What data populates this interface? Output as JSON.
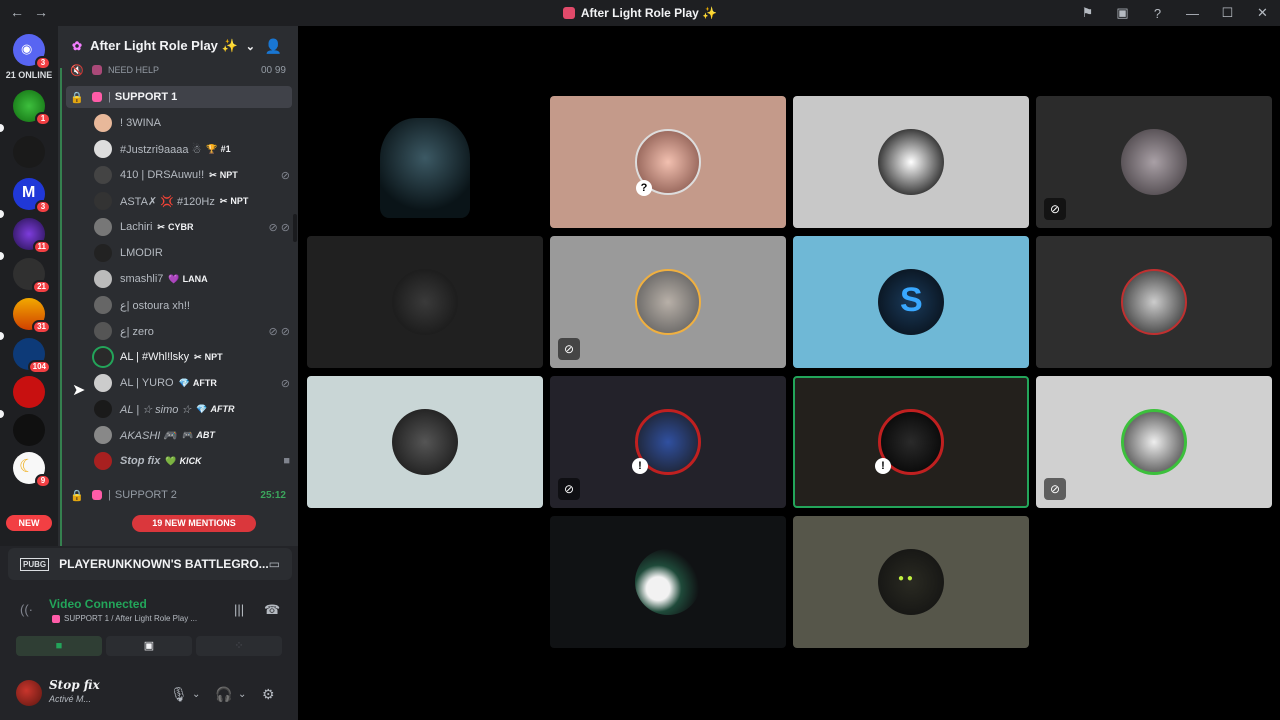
{
  "window": {
    "title": "After Light Role Play ✨",
    "nav_back": "←",
    "nav_forward": "→",
    "icons": [
      "flag-icon",
      "inbox-icon",
      "help-icon",
      "minimize-icon",
      "maximize-icon",
      "close-icon"
    ]
  },
  "guilds": {
    "online_label": "21 ONLINE",
    "new_label": "NEW",
    "badges": [
      "3",
      "1",
      "3",
      "11",
      "21",
      "31",
      "104",
      "9"
    ]
  },
  "server": {
    "name": "After Light Role Play ✨"
  },
  "channels": {
    "need_help": {
      "name": "NEED HELP",
      "count_a": "00",
      "count_b": "99"
    },
    "support1": {
      "name": "SUPPORT 1"
    },
    "support2": {
      "name": "SUPPORT 2",
      "timer": "25:12"
    },
    "users": [
      {
        "name": "! 3WINA",
        "tag": "",
        "tag_icon": ""
      },
      {
        "name": "#Justzri9aaaa ☃",
        "tag": "#1",
        "tag_icon": "🏆"
      },
      {
        "name": "410 | DRSAuwu!!",
        "tag": "NPT",
        "tag_icon": "✂"
      },
      {
        "name": "ASTA✗ 💢 #120Hz",
        "tag": "NPT",
        "tag_icon": "✂"
      },
      {
        "name": "Lachiri",
        "tag": "CYBR",
        "tag_icon": "✂"
      },
      {
        "name": "LMODIR",
        "tag": "",
        "tag_icon": ""
      },
      {
        "name": "smashli7",
        "tag": "LANA",
        "tag_icon": "💜"
      },
      {
        "name": "ع| ostoura xh!!",
        "tag": "",
        "tag_icon": ""
      },
      {
        "name": "ع| zero",
        "tag": "",
        "tag_icon": ""
      },
      {
        "name": "AL | #Whl!lsky",
        "tag": "NPT",
        "tag_icon": "✂"
      },
      {
        "name": "AL | YURO",
        "tag": "AFTR",
        "tag_icon": "💎"
      },
      {
        "name": "AL | ☆ simo ☆",
        "tag": "AFTR",
        "tag_icon": "💎"
      },
      {
        "name": "AKASHI 🎮",
        "tag": "ABT",
        "tag_icon": "🎮"
      },
      {
        "name": "Stop fix",
        "tag": "KICK",
        "tag_icon": "💚"
      }
    ],
    "mentions": "19 NEW MENTIONS"
  },
  "panel": {
    "game": "PLAYERUNKNOWN'S BATTLEGRO...",
    "game_badge": "PUBG",
    "connected": "Video Connected",
    "location": "SUPPORT 1 / After Light Role Play ...",
    "user_name": "Stop fix",
    "user_status": "Activé M..."
  },
  "colors": {
    "accent_green": "#23a55a",
    "danger_red": "#f23f43",
    "channel_bg": "#2b2d31",
    "guild_bg": "#1e1f22"
  }
}
